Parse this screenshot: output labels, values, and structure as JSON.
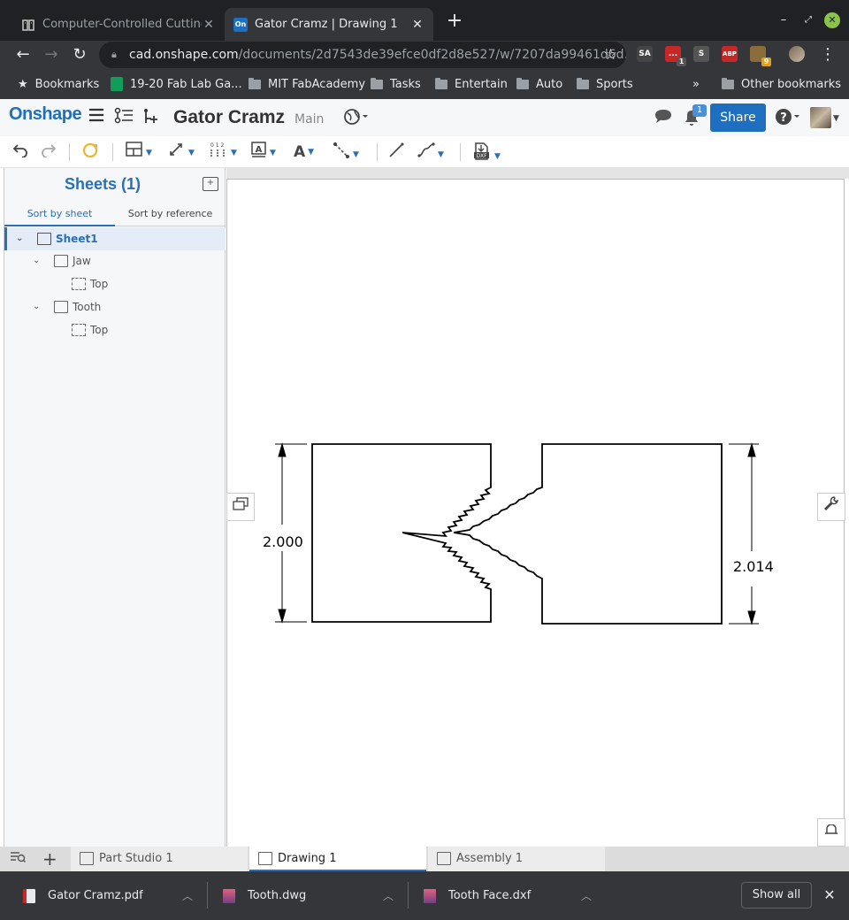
{
  "browser": {
    "tabs": [
      {
        "title": "Computer-Controlled Cutting",
        "active": false,
        "icon": "book-icon"
      },
      {
        "title": "Gator Cramz | Drawing 1",
        "active": true,
        "icon": "onshape-favicon"
      }
    ],
    "url_domain": "cad.onshape.com",
    "url_path": "/documents/2d7543de39efce0df2d8e527/w/7207da99461d6d...",
    "extensions": [
      {
        "label": "SA",
        "color": "#444"
      },
      {
        "label": "...",
        "color": "#c62828",
        "badge": "1"
      },
      {
        "label": "S",
        "color": "#555"
      },
      {
        "label": "ABP",
        "color": "#c62828"
      },
      {
        "label": "",
        "color": "#8a6d3b",
        "badge": "9"
      }
    ],
    "bookmarks": [
      {
        "label": "Bookmarks",
        "icon": "star-icon"
      },
      {
        "label": "19-20 Fab Lab Ga...",
        "icon": "sheets-icon"
      },
      {
        "label": "MIT FabAcademy",
        "icon": "folder-icon"
      },
      {
        "label": "Tasks",
        "icon": "folder-icon"
      },
      {
        "label": "Entertain",
        "icon": "folder-icon"
      },
      {
        "label": "Auto",
        "icon": "folder-icon"
      },
      {
        "label": "Sports",
        "icon": "folder-icon"
      }
    ],
    "bookmarks_overflow": "»",
    "other_bookmarks": "Other bookmarks"
  },
  "app": {
    "logo": "Onshape",
    "document_title": "Gator Cramz",
    "branch": "Main",
    "share_label": "Share",
    "notification_count": "1",
    "brand_color": "#1f6fc1"
  },
  "sidebar": {
    "title": "Sheets (1)",
    "sort_tabs": [
      "Sort by sheet",
      "Sort by reference"
    ],
    "tree": [
      {
        "label": "Sheet1",
        "level": 0,
        "selected": true
      },
      {
        "label": "Jaw",
        "level": 1
      },
      {
        "label": "Top",
        "level": 2
      },
      {
        "label": "Tooth",
        "level": 1
      },
      {
        "label": "Top",
        "level": 2
      }
    ]
  },
  "drawing": {
    "dimension_left": "2.000",
    "dimension_right": "2.014"
  },
  "bottom_tabs": [
    {
      "label": "Part Studio 1",
      "active": false
    },
    {
      "label": "Drawing 1",
      "active": true
    },
    {
      "label": "Assembly 1",
      "active": false
    }
  ],
  "downloads": {
    "items": [
      {
        "name": "Gator Cramz.pdf",
        "icon": "pdf-file-icon"
      },
      {
        "name": "Tooth.dwg",
        "icon": "image-file-icon"
      },
      {
        "name": "Tooth Face.dxf",
        "icon": "image-file-icon"
      }
    ],
    "show_all": "Show all"
  }
}
